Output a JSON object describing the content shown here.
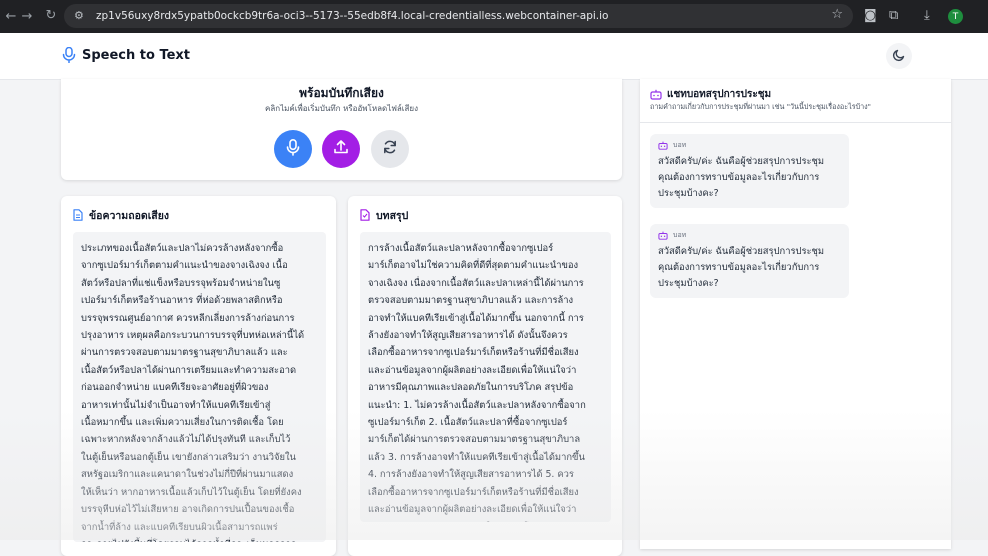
{
  "browser": {
    "url": "zp1v56uxy8rdx5ypatb0ockcb9tr6a-oci3--5173--55edb8f4.local-credentialless.webcontainer-api.io",
    "profile_initial": "T"
  },
  "header": {
    "title": "Speech to Text"
  },
  "recorder": {
    "title": "พร้อมบันทึกเสียง",
    "subtitle": "คลิกไมค์เพื่อเริ่มบันทึก หรืออัพโหลดไฟล์เสียง"
  },
  "transcript": {
    "heading": "ข้อความถอดเสียง",
    "text": "ประเภทของเนื้อสัตว์และปลาไม่ควรล้างหลังจากซื้อ\nจากซูเปอร์มาร์เก็ตตามคำแนะนำของจางเฉิงจง เนื้อ\nสัตว์หรือปลาที่แช่แข็งหรือบรรจุพร้อมจำหน่ายในซู\nเปอร์มาร์เก็ตหรือร้านอาหาร ที่ห่อด้วยพลาสติกหรือ\nบรรจุพรรณศูนย์อากาศ ควรหลีกเลี่ยงการล้างก่อนการ\nปรุงอาหาร เหตุผลคือกระบวนการบรรจุที่บทห่อเหล่านี้ได้\nผ่านการตรวจสอบตามมาตรฐานสุขาภิบาลแล้ว และ\nเนื้อสัตว์หรือปลาได้ผ่านการเตรียมและทำความสะอาด\nก่อนออกจำหน่าย แบคทีเรียจะอาศัยอยู่ที่ผิวของ\nอาหารเท่านั้นไม่จำเป็นอาจทำให้แบคทีเรียเข้าสู่\nเนื้อหมากขึ้น และเพิ่มความเสี่ยงในการติดเชื้อ โดย\nเฉพาะหากหลังจากล้างแล้วไม่ได้ปรุงทันที และเก็บไว้\nในตู้เย็นหรือนอกตู้เย็น เขายังกล่าวเสริมว่า งานวิจัยใน\nสหรัฐอเมริกาและแคนาดาในช่วงไม่กี่ปีที่ผ่านมาแสดง\nให้เห็นว่า หากอาหารเนื้อแล้วเก็บไว้ในตู้เย็น โดยที่ยังคง\nบรรจุหีบห่อไว้ไม่เสียหาย อาจเกิดการปนเปื้อนของเชื้อ\nจากน้ำที่ล้าง และแบคทีเรียบนผิวเนื้อสามารถแพร่\nกระจายไปยังพื้นที่โดยรอบได้จากน้ำที่กระเด็นนอกจาก"
  },
  "summary": {
    "heading": "บทสรุป",
    "text": "การล้างเนื้อสัตว์และปลาหลังจากซื้อจากซูเปอร์\nมาร์เก็ตอาจไม่ใช่ความคิดที่ดีที่สุดตามคำแนะนำของ\nจางเฉิงจง เนื่องจากเนื้อสัตว์และปลาเหล่านี้ได้ผ่านการ\nตรวจสอบตามมาตรฐานสุขาภิบาลแล้ว และการล้าง\nอาจทำให้แบคทีเรียเข้าสู่เนื้อได้มากขึ้น นอกจากนี้ การ\nล้างยังอาจทำให้สูญเสียสารอาหารได้ ดังนั้นจึงควร\nเลือกซื้ออาหารจากซูเปอร์มาร์เก็ตหรือร้านที่มีชื่อเสียง\nและอ่านข้อมูลจากผู้ผลิตอย่างละเอียดเพื่อให้แน่ใจว่า\nอาหารมีคุณภาพและปลอดภัยในการบริโภค สรุปข้อ\nแนะนำ: 1. ไม่ควรล้างเนื้อสัตว์และปลาหลังจากซื้อจาก\nซูเปอร์มาร์เก็ต 2. เนื้อสัตว์และปลาที่ซื้อจากซูเปอร์\nมาร์เก็ตได้ผ่านการตรวจสอบตามมาตรฐานสุขาภิบาล\nแล้ว 3. การล้างอาจทำให้แบคทีเรียเข้าสู่เนื้อได้มากขึ้น\n4. การล้างยังอาจทำให้สูญเสียสารอาหารได้ 5. ควร\nเลือกซื้ออาหารจากซูเปอร์มาร์เก็ตหรือร้านที่มีชื่อเสียง\nและอ่านข้อมูลจากผู้ผลิตอย่างละเอียดเพื่อให้แน่ใจว่า\nอาหารมีคุณภาพและปลอดภัยในการบริโภค"
  },
  "chat": {
    "heading": "แชทบอทสรุปการประชุม",
    "hint": "ถามคำถามเกี่ยวกับการประชุมที่ผ่านมา เช่น \"วันนี้ประชุมเรื่องอะไรบ้าง\"",
    "messages": [
      {
        "sender": "บอท",
        "text": "สวัสดีครับ/ค่ะ ฉันคือผู้ช่วยสรุปการประชุม คุณต้องการทราบข้อมูลอะไรเกี่ยวกับการประชุมบ้างคะ?"
      },
      {
        "sender": "บอท",
        "text": "สวัสดีครับ/ค่ะ ฉันคือผู้ช่วยสรุปการประชุม คุณต้องการทราบข้อมูลอะไรเกี่ยวกับการประชุมบ้างคะ?"
      }
    ]
  },
  "colors": {
    "accent_blue": "#3b82f6",
    "accent_purple": "#a31ee5",
    "bot_purple": "#9333ea"
  }
}
